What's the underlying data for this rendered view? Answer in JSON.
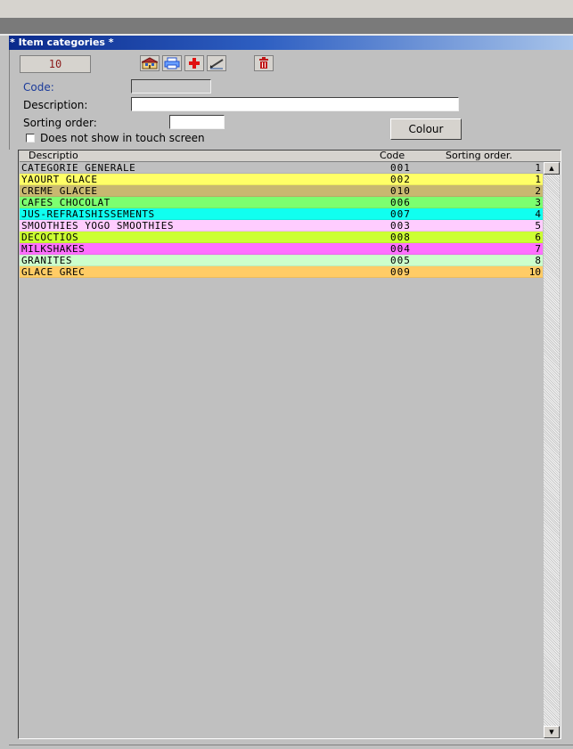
{
  "window": {
    "title": "* Item categories *"
  },
  "toolbar": {
    "count": "10",
    "buttons": [
      {
        "name": "home-icon",
        "color": "#b03030"
      },
      {
        "name": "print-icon",
        "color": "#1e4fcf"
      },
      {
        "name": "add-icon",
        "color": "#e01010"
      },
      {
        "name": "edit-icon",
        "color": "#404040"
      },
      {
        "name": "delete-icon",
        "color": "#c01818"
      }
    ]
  },
  "form": {
    "code_label": "Code:",
    "code_value": "",
    "description_label": "Description:",
    "description_value": "",
    "sorting_label": "Sorting order:",
    "sorting_value": "",
    "touch_label": "Does not show in touch screen",
    "touch_checked": false,
    "colour_button": "Colour"
  },
  "grid": {
    "headers": {
      "description": "Descriptio",
      "code": "Code",
      "sorting": "Sorting order."
    },
    "rows": [
      {
        "description": "CATEGORIE GENERALE",
        "code": "001",
        "sorting": "1",
        "color": "#c0c0c0"
      },
      {
        "description": "YAOURT GLACE",
        "code": "002",
        "sorting": "1",
        "color": "#ffff66"
      },
      {
        "description": "CREME GLACEE",
        "code": "010",
        "sorting": "2",
        "color": "#c8b870"
      },
      {
        "description": "CAFES CHOCOLAT",
        "code": "006",
        "sorting": "3",
        "color": "#7cff70"
      },
      {
        "description": "JUS-REFRAISHISSEMENTS",
        "code": "007",
        "sorting": "4",
        "color": "#10fff0"
      },
      {
        "description": "SMOOTHIES YOGO SMOOTHIES",
        "code": "003",
        "sorting": "5",
        "color": "#ffccff"
      },
      {
        "description": "DECOCTIOS",
        "code": "008",
        "sorting": "6",
        "color": "#ccff33"
      },
      {
        "description": "MILKSHAKES",
        "code": "004",
        "sorting": "7",
        "color": "#ff70ff"
      },
      {
        "description": "GRANITES",
        "code": "005",
        "sorting": "8",
        "color": "#ccffcc"
      },
      {
        "description": "GLACE GREC",
        "code": "009",
        "sorting": "10",
        "color": "#ffcc66"
      }
    ]
  }
}
